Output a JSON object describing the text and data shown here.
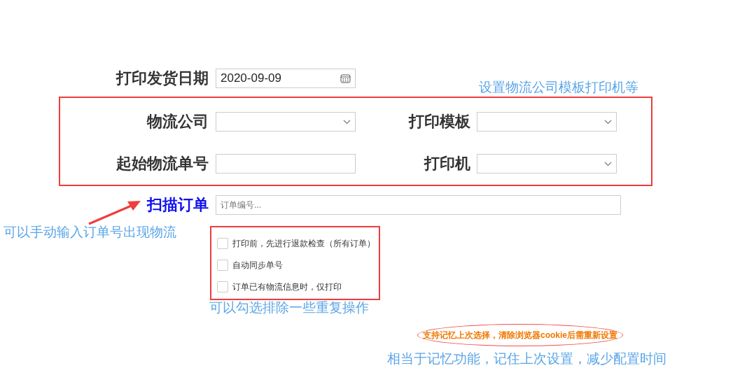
{
  "date_field": {
    "label": "打印发货日期",
    "value": "2020-09-09"
  },
  "settings": [
    {
      "label": "物流公司",
      "kind": "select"
    },
    {
      "label": "打印模板",
      "kind": "select"
    },
    {
      "label": "起始物流单号",
      "kind": "text"
    },
    {
      "label": "打印机",
      "kind": "select"
    }
  ],
  "scan": {
    "label": "扫描订单",
    "placeholder": "订单编号..."
  },
  "options": [
    {
      "label": "打印前，先进行退款检查（所有订单）",
      "checked": false
    },
    {
      "label": "自动同步单号",
      "checked": false
    },
    {
      "label": "订单已有物流信息时，仅打印",
      "checked": false
    }
  ],
  "notice": "支持记忆上次选择，清除浏览器cookie后需重新设置",
  "annotations": [
    "设置物流公司模板打印机等",
    "可以手动输入订单号出现物流",
    "可以勾选排除一些重复操作",
    "相当于记忆功能，记住上次设置，减少配置时间"
  ]
}
